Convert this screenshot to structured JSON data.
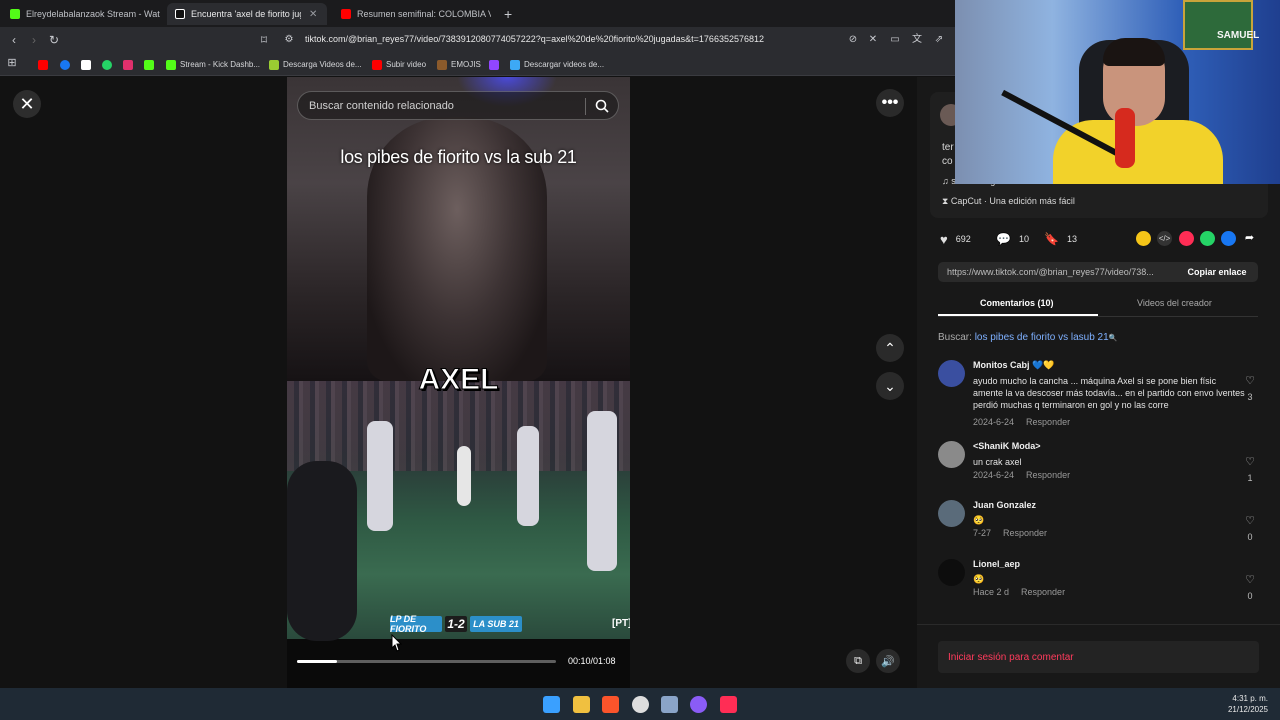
{
  "browser": {
    "tabs": [
      {
        "label": "Elreydelabalanzaok Stream - Wat",
        "color": "#53fc18"
      },
      {
        "label": "Encuentra 'axel de fiorito jugadas'",
        "color": "#ffffff"
      },
      {
        "label": "Resumen semifinal: COLOMBIA VS BR",
        "color": "#ff0000"
      }
    ],
    "url": "tiktok.com/@brian_reyes77/video/7383912080774057222?q=axel%20de%20fiorito%20jugadas&t=1766352576812",
    "bookmarks": [
      {
        "label": "",
        "color": "#ff0000"
      },
      {
        "label": "",
        "color": "#1877f2"
      },
      {
        "label": "",
        "color": "#ffffff"
      },
      {
        "label": "",
        "color": "#25d366"
      },
      {
        "label": "",
        "color": "#e1306c"
      },
      {
        "label": "",
        "color": "#53fc18"
      },
      {
        "label": "Stream - Kick Dashb...",
        "color": "#53fc18"
      },
      {
        "label": "Descarga Videos de...",
        "color": "#9acd32"
      },
      {
        "label": "Subir video",
        "color": "#ff0000"
      },
      {
        "label": "EMOJIS",
        "color": "#8b5a2b"
      },
      {
        "label": "",
        "color": "#9146ff"
      },
      {
        "label": "Descargar videos de...",
        "color": "#3da9f5"
      }
    ]
  },
  "video": {
    "search_placeholder": "Buscar contenido relacionado",
    "overlay_title": "los pibes de fiorito vs la sub 21",
    "overlay_name": "AXEL",
    "score_left": "LP DE FIORITO",
    "score": "1-2",
    "score_right": "LA SUB 21",
    "badge": "[PT]",
    "time": "00:10/01:08",
    "progress": 0.155
  },
  "panel": {
    "desc_partial_1": "ter",
    "desc_partial_2": "co",
    "sound": "sonido original - Brian",
    "capcut": "CapCut · Una edición más fácil",
    "likes": "692",
    "comments": "10",
    "saves": "13",
    "share_colors": [
      "#f5c518",
      "#ffffff",
      "#ff2d55",
      "#25d366",
      "#1877f2",
      "#ffffff"
    ],
    "link": "https://www.tiktok.com/@brian_reyes77/video/738...",
    "copy_label": "Copiar enlace",
    "tab_comments": "Comentarios (10)",
    "tab_creator": "Videos del creador",
    "search_prefix": "Buscar:",
    "search_term": "los pibes de fiorito vs lasub 21",
    "login": "Iniciar sesión para comentar",
    "reply_label": "Responder",
    "comments_list": [
      {
        "user": "Monitos Cabj 💙💛",
        "text": "ayudo mucho la cancha ... máquina Axel si se pone bien físic amente la va descoser más todavía... en el partido con envo lventes perdió muchas q terminaron en gol y no las corre",
        "date": "2024-6-24",
        "likes": "3",
        "avatar": "#3a4fa0"
      },
      {
        "user": "<ShaniK Moda>",
        "text": "un crak axel",
        "date": "2024-6-24",
        "likes": "1",
        "avatar": "#8a8a8a"
      },
      {
        "user": "Juan Gonzalez",
        "text": "🥺",
        "date": "7-27",
        "likes": "0",
        "avatar": "#5a6b7a"
      },
      {
        "user": "Lionel_aep",
        "text": "🥺",
        "date": "Hace 2 d",
        "likes": "0",
        "avatar": "#0d0d0d"
      }
    ]
  },
  "webcam": {
    "tag": "SAMUEL"
  },
  "taskbar": {
    "icons": [
      {
        "name": "windows-start-icon",
        "color": "#3aa0ff"
      },
      {
        "name": "file-explorer-icon",
        "color": "#f0c040"
      },
      {
        "name": "brave-browser-icon",
        "color": "#fb542b"
      },
      {
        "name": "obs-icon",
        "color": "#dddddd"
      },
      {
        "name": "settings-icon",
        "color": "#8aa4c8"
      },
      {
        "name": "app-circle-icon",
        "color": "#8a5cf6"
      },
      {
        "name": "tiktok-app-icon",
        "color": "#ff2d55"
      }
    ],
    "time": "4:31 p. m.",
    "date": "21/12/2025"
  }
}
